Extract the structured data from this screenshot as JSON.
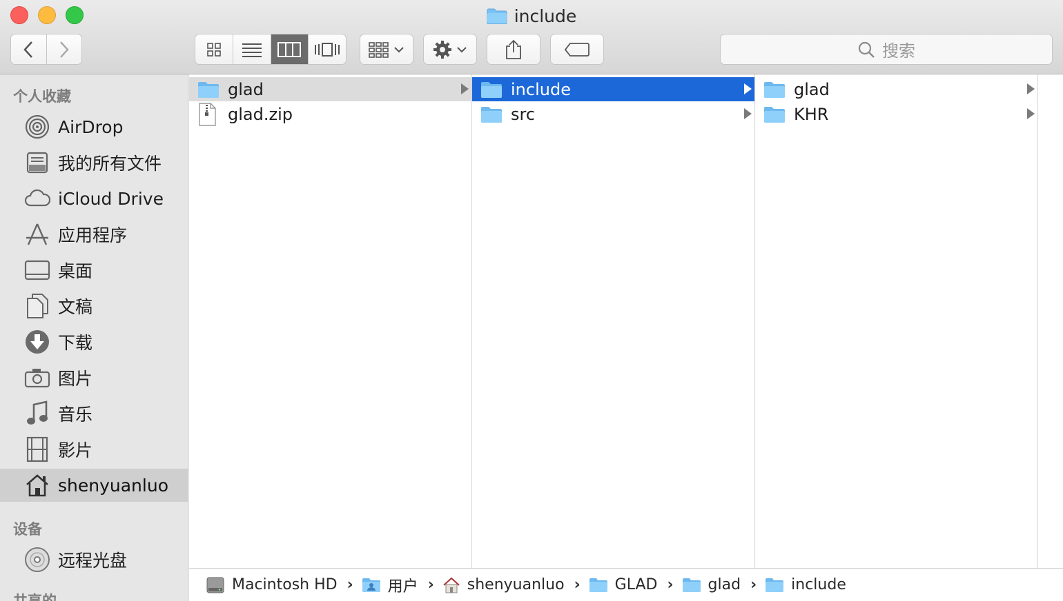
{
  "window": {
    "title": "include"
  },
  "toolbar": {
    "back": "back",
    "forward": "forward",
    "views": [
      "icon-view",
      "list-view",
      "column-view",
      "gallery-view"
    ],
    "active_view": "column-view",
    "search_placeholder": "搜索"
  },
  "sidebar": {
    "favorites_header": "个人收藏",
    "favorites": [
      {
        "label": "AirDrop",
        "icon": "airdrop-icon"
      },
      {
        "label": "我的所有文件",
        "icon": "all-files-icon"
      },
      {
        "label": "iCloud Drive",
        "icon": "cloud-icon"
      },
      {
        "label": "应用程序",
        "icon": "applications-icon"
      },
      {
        "label": "桌面",
        "icon": "desktop-icon"
      },
      {
        "label": "文稿",
        "icon": "documents-icon"
      },
      {
        "label": "下载",
        "icon": "download-icon"
      },
      {
        "label": "图片",
        "icon": "camera-icon"
      },
      {
        "label": "音乐",
        "icon": "music-icon"
      },
      {
        "label": "影片",
        "icon": "film-icon"
      },
      {
        "label": "shenyuanluo",
        "icon": "home-icon",
        "selected": true
      }
    ],
    "devices_header": "设备",
    "devices": [
      {
        "label": "远程光盘",
        "icon": "disc-icon"
      }
    ],
    "shared_header": "共享的"
  },
  "columns": [
    {
      "items": [
        {
          "name": "glad",
          "kind": "folder",
          "state": "inactive-selected",
          "has_children": true
        },
        {
          "name": "glad.zip",
          "kind": "zip"
        }
      ]
    },
    {
      "items": [
        {
          "name": "include",
          "kind": "folder",
          "state": "selected",
          "has_children": true
        },
        {
          "name": "src",
          "kind": "folder",
          "has_children": true
        }
      ]
    },
    {
      "items": [
        {
          "name": "glad",
          "kind": "folder",
          "has_children": true
        },
        {
          "name": "KHR",
          "kind": "folder",
          "has_children": true
        }
      ]
    }
  ],
  "pathbar": [
    {
      "label": "Macintosh HD",
      "icon": "hard-drive-icon"
    },
    {
      "label": "用户",
      "icon": "users-folder-icon"
    },
    {
      "label": "shenyuanluo",
      "icon": "home-icon"
    },
    {
      "label": "GLAD",
      "icon": "folder-icon"
    },
    {
      "label": "glad",
      "icon": "folder-icon"
    },
    {
      "label": "include",
      "icon": "folder-icon"
    }
  ],
  "colors": {
    "selection": "#1c68d9",
    "folder": "#7cc2f4",
    "sidebar_selected": "#cfcfcf"
  }
}
